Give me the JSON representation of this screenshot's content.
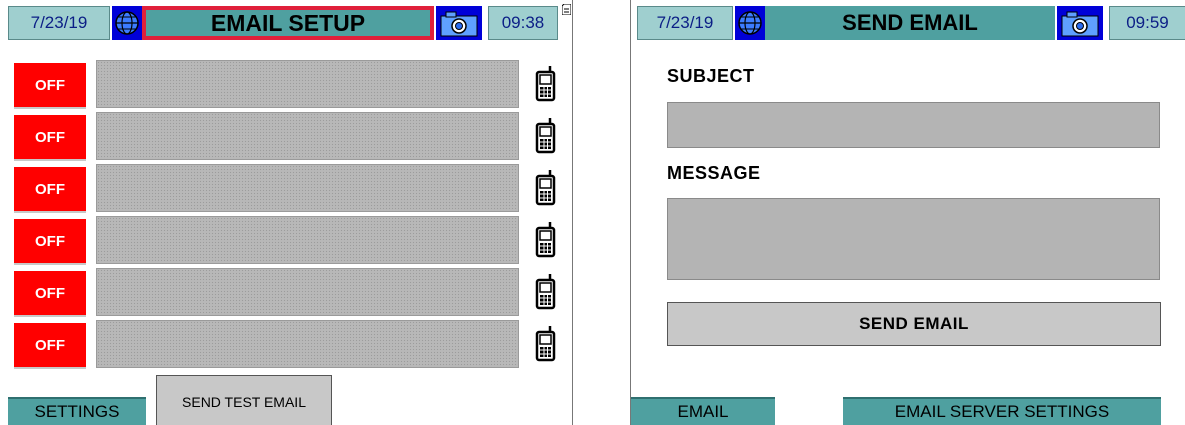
{
  "email_setup": {
    "date": "7/23/19",
    "title": "EMAIL SETUP",
    "time": "09:38",
    "rows": [
      {
        "toggle": "OFF"
      },
      {
        "toggle": "OFF"
      },
      {
        "toggle": "OFF"
      },
      {
        "toggle": "OFF"
      },
      {
        "toggle": "OFF"
      },
      {
        "toggle": "OFF"
      }
    ],
    "settings_tab": "SETTINGS",
    "send_test_button": "SEND TEST EMAIL"
  },
  "send_email": {
    "date": "7/23/19",
    "title": "SEND EMAIL",
    "time": "09:59",
    "subject_label": "SUBJECT",
    "message_label": "MESSAGE",
    "send_button": "SEND EMAIL",
    "email_tab": "EMAIL",
    "server_settings_tab": "EMAIL SERVER SETTINGS"
  },
  "colors": {
    "header_teal": "#4fa0a0",
    "header_light": "#9fcfcf",
    "text_blue": "#0b1e86",
    "toggle_off": "#ff0000",
    "highlight_red": "#e0203a",
    "icon_blue": "#0000d8"
  },
  "icons": {
    "network": "globe-icon",
    "camera": "camera-icon",
    "device": "phone-icon",
    "storage": "sd-card-icon"
  }
}
